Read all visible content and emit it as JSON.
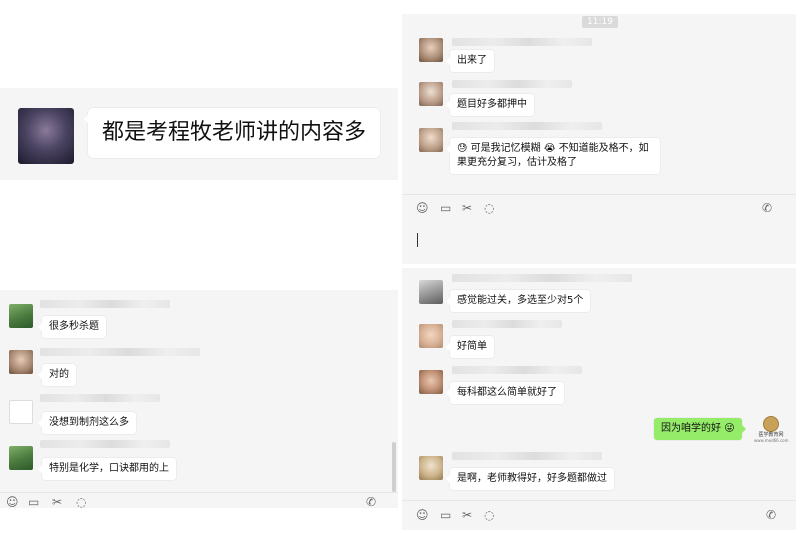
{
  "top_left": {
    "message": "都是考程牧老师讲的内容多"
  },
  "top_right": {
    "timestamp": "11:19",
    "messages": [
      {
        "text": "出来了"
      },
      {
        "text": "题目好多都押中"
      },
      {
        "line1": "可是我记忆模糊",
        "line1b": "不知道能及格不，如",
        "line2": "果更充分复习，估计及格了"
      }
    ],
    "toolbar": [
      "emoji-icon",
      "folder-icon",
      "scissors-icon",
      "chat-icon",
      "phone-icon"
    ]
  },
  "bottom_left": {
    "messages": [
      {
        "text": "很多秒杀题"
      },
      {
        "text": "对的"
      },
      {
        "text": "没想到制剂这么多"
      },
      {
        "text": "特别是化学，口诀都用的上"
      }
    ],
    "toolbar": [
      "emoji-icon",
      "folder-icon",
      "scissors-icon",
      "chat-icon",
      "phone-icon"
    ]
  },
  "bottom_right": {
    "messages": [
      {
        "text": "感觉能过关，多选至少对5个"
      },
      {
        "text": "好简单"
      },
      {
        "text": "每科都这么简单就好了"
      },
      {
        "text": "因为咱学的好",
        "sender": "self"
      },
      {
        "text": "是啊，老师教得好，好多题都做过"
      }
    ],
    "logo_text": "医学教育网",
    "logo_sub": "www.med66.com",
    "toolbar": [
      "emoji-icon",
      "folder-icon",
      "scissors-icon",
      "chat-icon",
      "phone-icon"
    ]
  },
  "colors": {
    "panel_bg": "#f5f5f5",
    "bubble_white": "#ffffff",
    "bubble_green": "#95ec69"
  }
}
